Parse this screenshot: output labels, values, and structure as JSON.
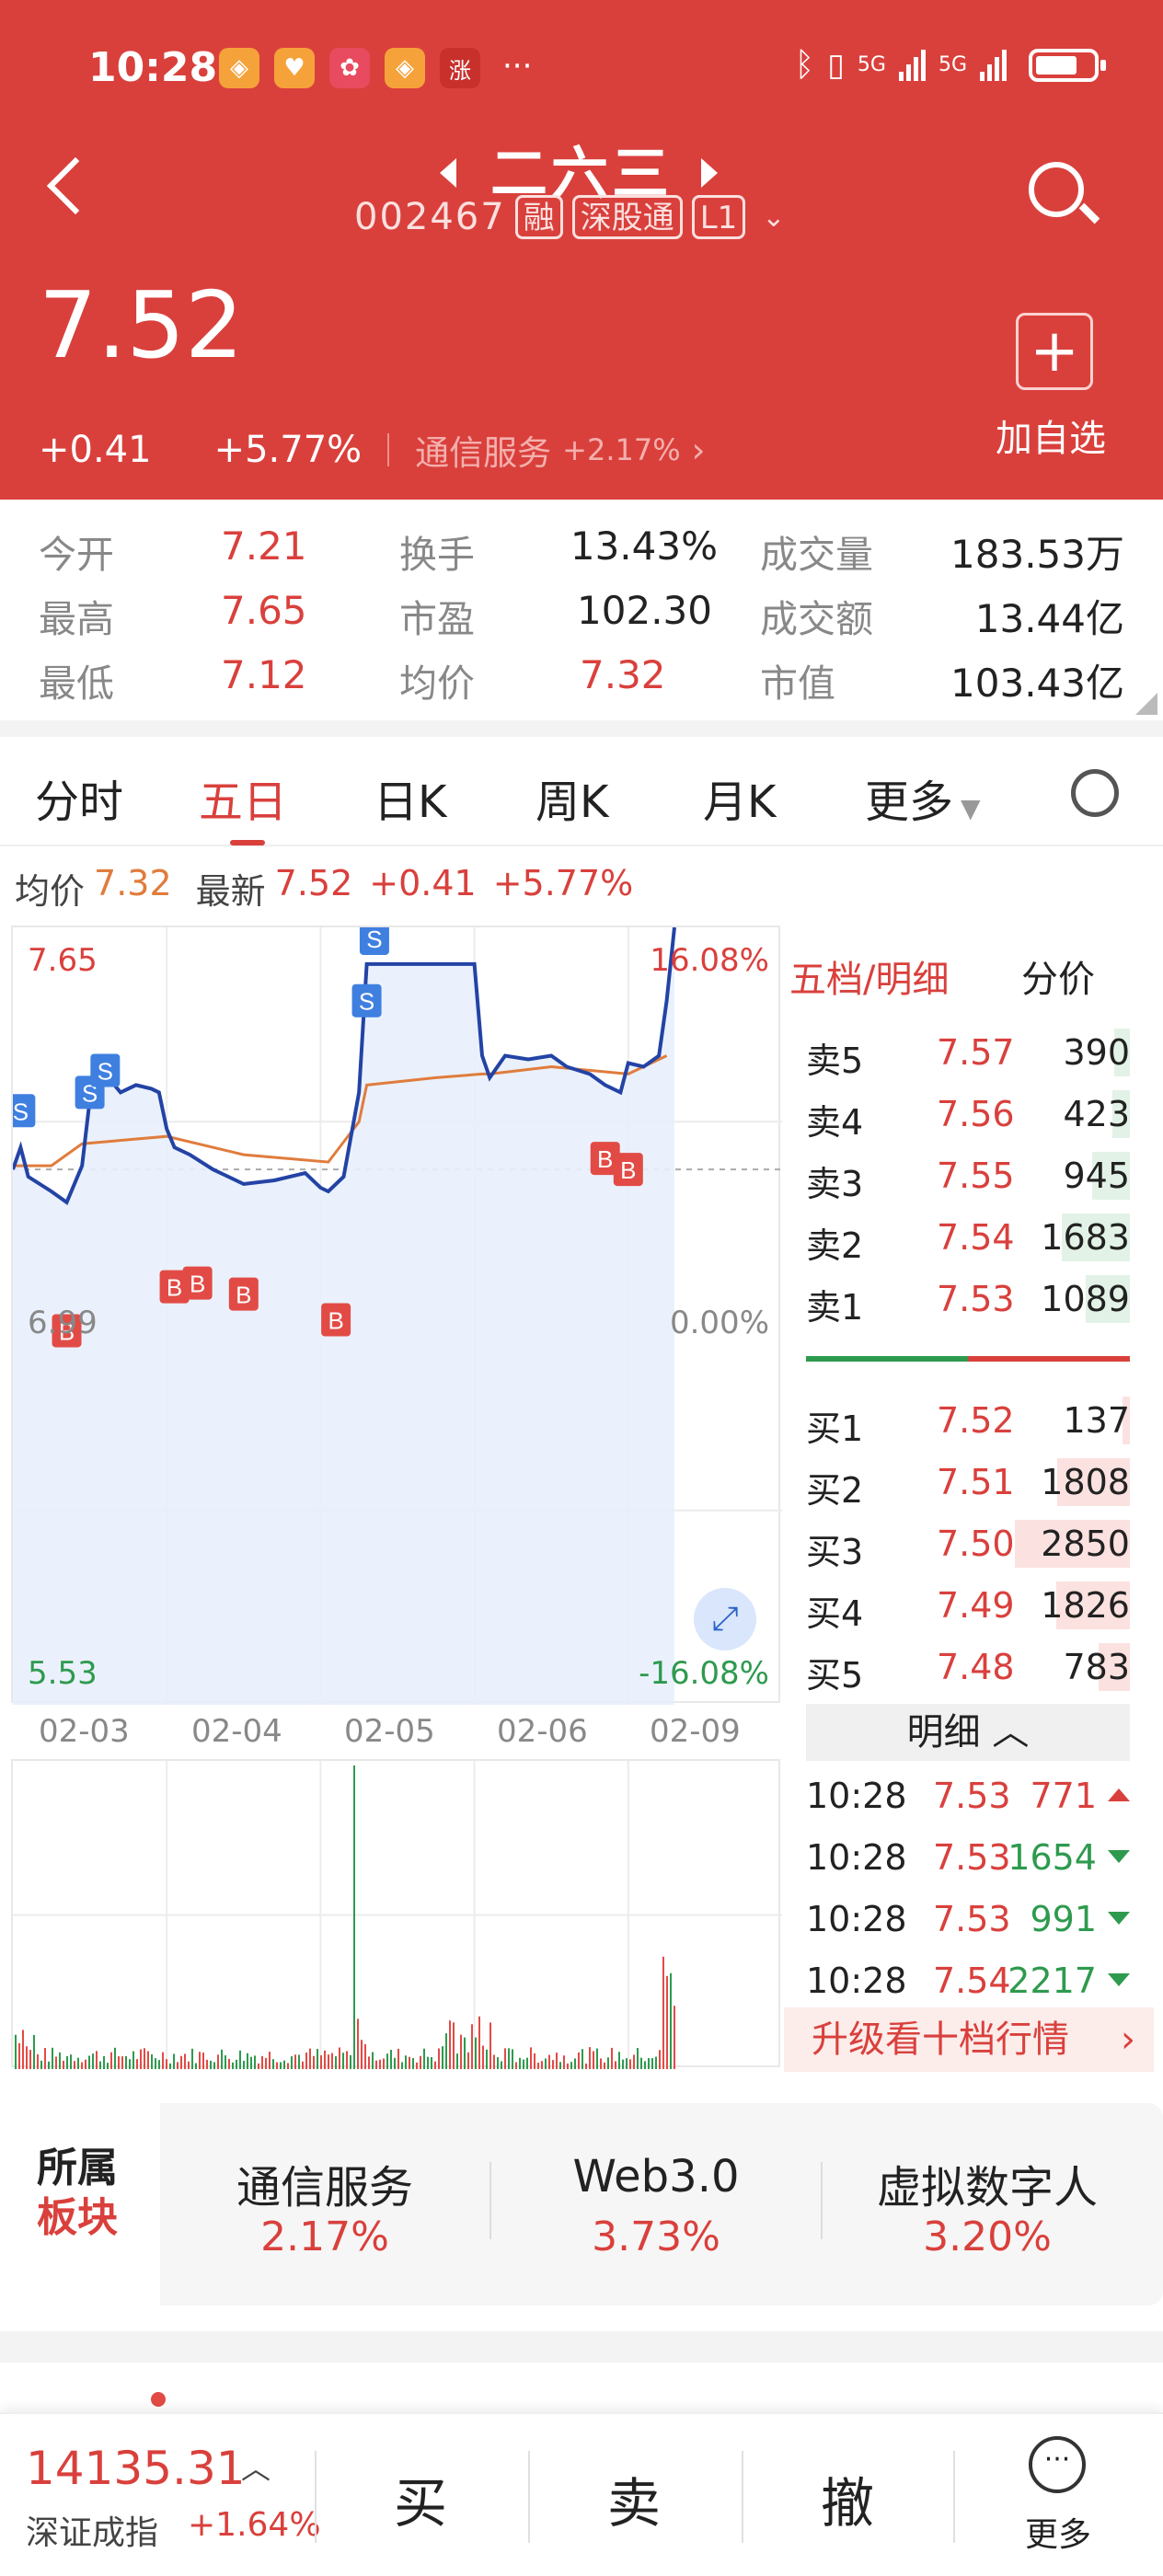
{
  "status_bar": {
    "time": "10:28",
    "dots": "···",
    "net1": "5G",
    "net2": "5G"
  },
  "header": {
    "name": "二六三",
    "code": "002467",
    "tags": [
      "融",
      "深股通",
      "L1"
    ],
    "price": "7.52",
    "change": "+0.41",
    "change_pct": "+5.77%",
    "sector": "通信服务",
    "sector_change": "+2.17%",
    "add_fav_label": "加自选"
  },
  "stats": {
    "open_label": "今开",
    "open": "7.21",
    "high_label": "最高",
    "high": "7.65",
    "low_label": "最低",
    "low": "7.12",
    "turnover_label": "换手",
    "turnover": "13.43%",
    "pe_label": "市盈",
    "pe": "102.30",
    "avg_label": "均价",
    "avg": "7.32",
    "volume_label": "成交量",
    "volume": "183.53万",
    "amount_label": "成交额",
    "amount": "13.44亿",
    "mktcap_label": "市值",
    "mktcap": "103.43亿"
  },
  "tabs": [
    "分时",
    "五日",
    "日K",
    "周K",
    "月K",
    "更多"
  ],
  "active_tab": "五日",
  "info_line": {
    "avg_label": "均价",
    "avg": "7.32",
    "latest_label": "最新",
    "latest": "7.52",
    "change": "+0.41",
    "pct": "+5.77%"
  },
  "chart": {
    "y_top": "7.65",
    "y_bottom": "5.53",
    "y_mid": "6.99",
    "pct_top": "16.08%",
    "pct_mid": "0.00%",
    "pct_bottom": "-16.08%",
    "dates": [
      "02-03",
      "02-04",
      "02-05",
      "02-06",
      "02-09"
    ],
    "buy_marker": "B",
    "sell_marker": "S"
  },
  "chart_data": {
    "type": "line",
    "x": [
      "02-03",
      "02-04",
      "02-05",
      "02-06",
      "02-09"
    ],
    "series": [
      {
        "values": [
          6.99,
          7.25,
          6.95,
          7.18,
          6.92,
          7.08,
          7.0,
          6.93,
          7.55,
          7.55,
          7.25,
          7.3,
          7.28,
          7.2,
          7.52
        ]
      },
      {
        "values": [
          6.99,
          7.02,
          7.03,
          7.0,
          7.02,
          7.0,
          7.1,
          7.2,
          7.23,
          7.22,
          7.24,
          7.25
        ]
      }
    ],
    "ylim": [
      5.53,
      7.65
    ]
  },
  "order_book": {
    "tab_active": "五档/明细",
    "tab_other": "分价",
    "asks": [
      {
        "label": "卖5",
        "price": "7.57",
        "vol": "390"
      },
      {
        "label": "卖4",
        "price": "7.56",
        "vol": "423"
      },
      {
        "label": "卖3",
        "price": "7.55",
        "vol": "945"
      },
      {
        "label": "卖2",
        "price": "7.54",
        "vol": "1683"
      },
      {
        "label": "卖1",
        "price": "7.53",
        "vol": "1089"
      }
    ],
    "bids": [
      {
        "label": "买1",
        "price": "7.52",
        "vol": "137"
      },
      {
        "label": "买2",
        "price": "7.51",
        "vol": "1808"
      },
      {
        "label": "买3",
        "price": "7.50",
        "vol": "2850"
      },
      {
        "label": "买4",
        "price": "7.49",
        "vol": "1826"
      },
      {
        "label": "买5",
        "price": "7.48",
        "vol": "783"
      }
    ],
    "detail_label": "明细",
    "trades": [
      {
        "time": "10:28",
        "price": "7.53",
        "vol": "771",
        "dir": "up"
      },
      {
        "time": "10:28",
        "price": "7.53",
        "vol": "1654",
        "dir": "down"
      },
      {
        "time": "10:28",
        "price": "7.53",
        "vol": "991",
        "dir": "down"
      },
      {
        "time": "10:28",
        "price": "7.54",
        "vol": "2217",
        "dir": "down"
      }
    ],
    "upgrade_label": "升级看十档行情"
  },
  "sectors": {
    "label_line1": "所属",
    "label_line2": "板块",
    "items": [
      {
        "name": "通信服务",
        "pct": "2.17%"
      },
      {
        "name": "Web3.0",
        "pct": "3.73%"
      },
      {
        "name": "虚拟数字人",
        "pct": "3.20%"
      }
    ]
  },
  "bottom_bar": {
    "index_value": "14135.31",
    "index_name": "深证成指",
    "index_change": "+1.64%",
    "buy": "买",
    "sell": "卖",
    "cancel": "撤",
    "more": "更多"
  },
  "colors": {
    "red": "#d9403c",
    "green": "#2e9a4e",
    "blue": "#2343a5",
    "orange": "#e07c3c"
  }
}
